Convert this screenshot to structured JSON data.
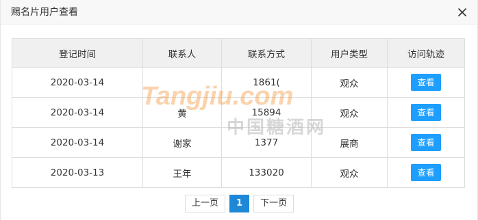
{
  "dialog": {
    "title": "赐名片用户查看"
  },
  "table": {
    "headers": [
      "登记时间",
      "联系人",
      "联系方式",
      "用户类型",
      "访问轨迹"
    ],
    "rows": [
      {
        "date": "2020-03-14",
        "contact": "",
        "phone": "1861(",
        "type": "观众",
        "action": "查看"
      },
      {
        "date": "2020-03-14",
        "contact": "黄",
        "phone": "15894",
        "type": "观众",
        "action": "查看"
      },
      {
        "date": "2020-03-14",
        "contact": "谢家",
        "phone": "1377",
        "type": "展商",
        "action": "查看"
      },
      {
        "date": "2020-03-13",
        "contact": "王年",
        "phone": "133020",
        "type": "观众",
        "action": "查看"
      }
    ]
  },
  "pagination": {
    "prev": "上一页",
    "current": "1",
    "next": "下一页"
  },
  "watermark": {
    "brand": "Tangjiu.com",
    "chinese": "中国糖酒网"
  },
  "colors": {
    "accent": "#1e9fff",
    "page_active": "#1e88d8",
    "header_bg": "#f8f8f8",
    "table_header_bg": "#f0f0f0"
  }
}
